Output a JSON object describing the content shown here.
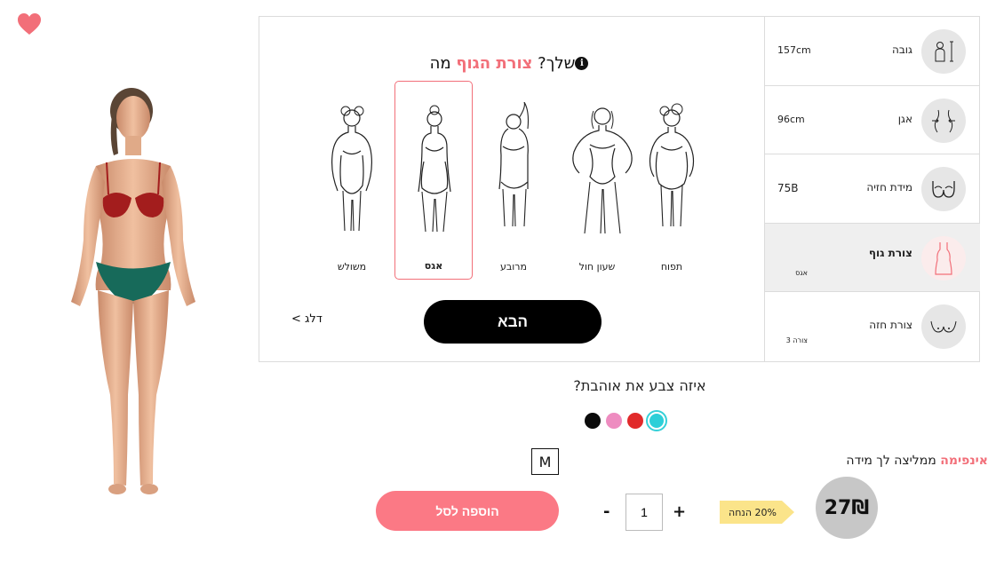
{
  "favorite": {
    "icon": "heart-icon",
    "color": "#f26f79"
  },
  "question": {
    "prefix": "מה",
    "highlight": "צורת הגוף",
    "suffix": "שלך?",
    "info_icon": "info-icon"
  },
  "shapes": [
    {
      "name": "משולש",
      "selected": false
    },
    {
      "name": "אגס",
      "selected": true
    },
    {
      "name": "מרובע",
      "selected": false
    },
    {
      "name": "שעון חול",
      "selected": false
    },
    {
      "name": "תפוח",
      "selected": false
    }
  ],
  "next_label": "הבא",
  "skip_label": "דלג >",
  "steps": [
    {
      "label": "גובה",
      "value": "157cm",
      "icon": "height-icon"
    },
    {
      "label": "אגן",
      "value": "96cm",
      "icon": "hips-icon"
    },
    {
      "label": "מידת חזיה",
      "value": "75B",
      "icon": "bra-icon"
    },
    {
      "label": "צורת גוף",
      "sub": "אגס",
      "icon": "body-shape-icon",
      "active": true
    },
    {
      "label": "צורת חזה",
      "sub": "צורה 3",
      "icon": "breast-shape-icon"
    }
  ],
  "color_question": "איזה צבע את אוהבת?",
  "colors": [
    {
      "name": "black",
      "hex": "#0b0b0b"
    },
    {
      "name": "pink",
      "hex": "#ee8cc0"
    },
    {
      "name": "red",
      "hex": "#e12a2a"
    },
    {
      "name": "turquoise",
      "hex": "#2ccfd8",
      "selected": true
    }
  ],
  "recommendation": {
    "brand": "אינפימה",
    "text": "ממליצה לך מידה",
    "size": "M"
  },
  "add_to_cart_label": "הוספה לסל",
  "quantity": "1",
  "minus_label": "-",
  "plus_label": "+",
  "discount_label": "20% הנחה",
  "discount_color": "#fbe48a",
  "price": "27₪",
  "accent_color": "#f26f79",
  "button_color": "#fb7985"
}
